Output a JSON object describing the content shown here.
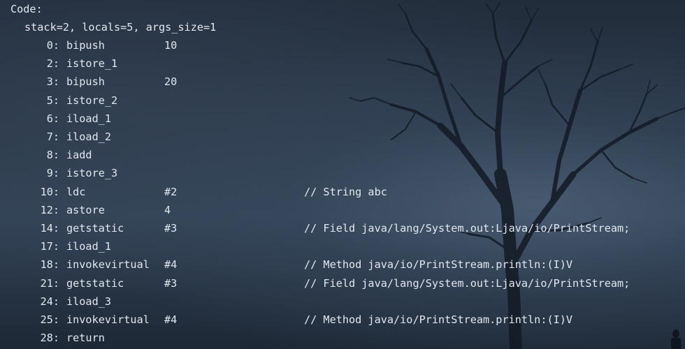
{
  "code_header": "Code:",
  "stack_info": "stack=2, locals=5, args_size=1",
  "instructions": [
    {
      "offset": "0:",
      "opcode": "bipush",
      "arg": "10",
      "comment": ""
    },
    {
      "offset": "2:",
      "opcode": "istore_1",
      "arg": "",
      "comment": ""
    },
    {
      "offset": "3:",
      "opcode": "bipush",
      "arg": "20",
      "comment": ""
    },
    {
      "offset": "5:",
      "opcode": "istore_2",
      "arg": "",
      "comment": ""
    },
    {
      "offset": "6:",
      "opcode": "iload_1",
      "arg": "",
      "comment": ""
    },
    {
      "offset": "7:",
      "opcode": "iload_2",
      "arg": "",
      "comment": ""
    },
    {
      "offset": "8:",
      "opcode": "iadd",
      "arg": "",
      "comment": ""
    },
    {
      "offset": "9:",
      "opcode": "istore_3",
      "arg": "",
      "comment": ""
    },
    {
      "offset": "10:",
      "opcode": "ldc",
      "arg": "#2",
      "comment": "// String abc"
    },
    {
      "offset": "12:",
      "opcode": "astore",
      "arg": "4",
      "comment": ""
    },
    {
      "offset": "14:",
      "opcode": "getstatic",
      "arg": "#3",
      "comment": "// Field java/lang/System.out:Ljava/io/PrintStream;"
    },
    {
      "offset": "17:",
      "opcode": "iload_1",
      "arg": "",
      "comment": ""
    },
    {
      "offset": "18:",
      "opcode": "invokevirtual",
      "arg": "#4",
      "comment": "// Method java/io/PrintStream.println:(I)V"
    },
    {
      "offset": "21:",
      "opcode": "getstatic",
      "arg": "#3",
      "comment": "// Field java/lang/System.out:Ljava/io/PrintStream;"
    },
    {
      "offset": "24:",
      "opcode": "iload_3",
      "arg": "",
      "comment": ""
    },
    {
      "offset": "25:",
      "opcode": "invokevirtual",
      "arg": "#4",
      "comment": "// Method java/io/PrintStream.println:(I)V"
    },
    {
      "offset": "28:",
      "opcode": "return",
      "arg": "",
      "comment": ""
    }
  ],
  "colors": {
    "text": "#e2e7ee",
    "background": "#1f2b3a"
  }
}
